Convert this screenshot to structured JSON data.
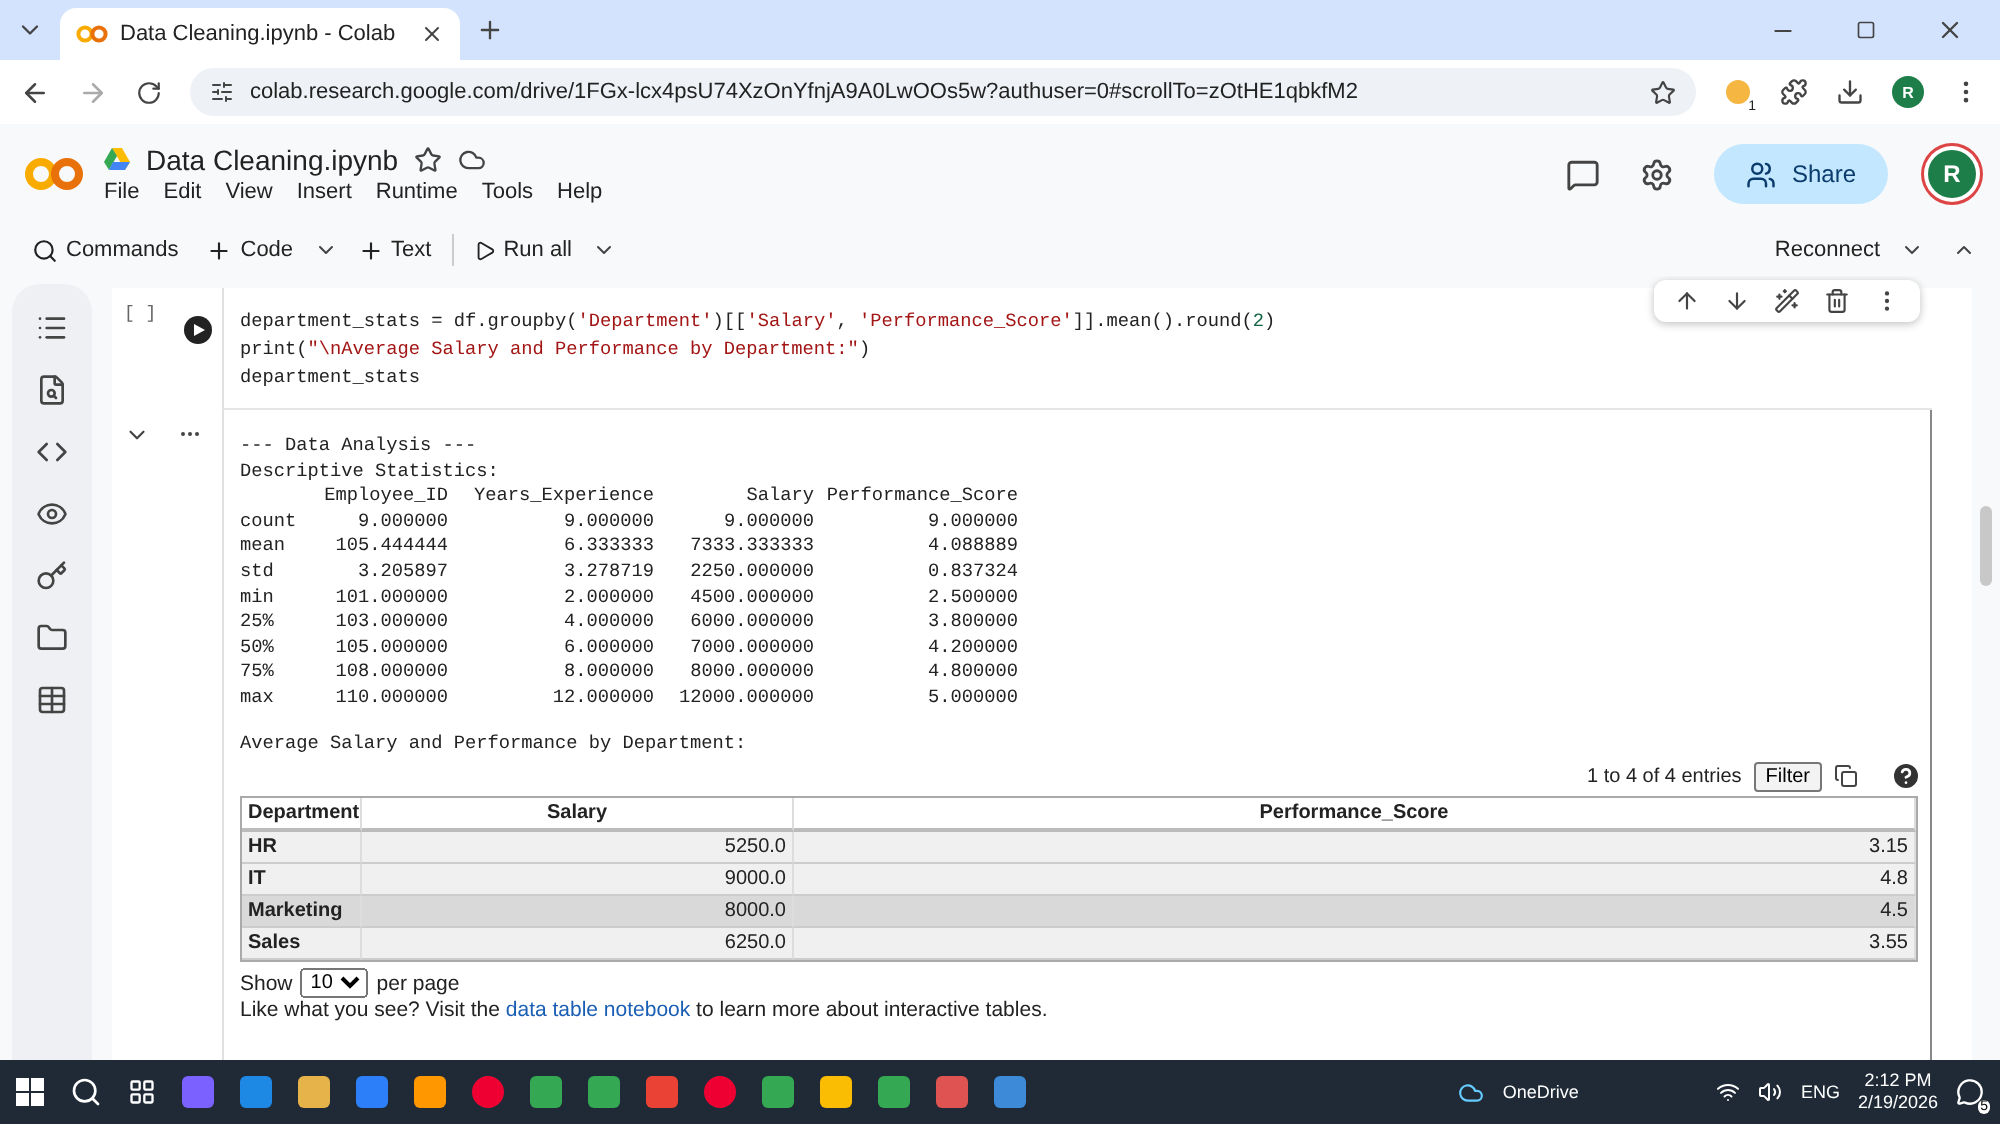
{
  "browser": {
    "tab_title": "Data Cleaning.ipynb - Colab",
    "url": "colab.research.google.com/drive/1FGx-lcx4psU74XzOnYfnjA9A0LwOOs5w?authuser=0#scrollTo=zOtHE1qbkfM2",
    "extension_badge": "1",
    "profile_initial": "R"
  },
  "notebook": {
    "title": "Data Cleaning.ipynb",
    "menu": [
      "File",
      "Edit",
      "View",
      "Insert",
      "Runtime",
      "Tools",
      "Help"
    ],
    "share": "Share",
    "avatar": "R"
  },
  "toolbar": {
    "commands": "Commands",
    "code": "Code",
    "text": "Text",
    "run_all": "Run all",
    "reconnect": "Reconnect"
  },
  "cell": {
    "exec_count": "[ ]",
    "code": [
      [
        {
          "text": "department_stats = df.groupby(",
          "kind": "plain"
        },
        {
          "text": "'Department'",
          "kind": "string"
        },
        {
          "text": ")[[",
          "kind": "plain"
        },
        {
          "text": "'Salary'",
          "kind": "string"
        },
        {
          "text": ", ",
          "kind": "plain"
        },
        {
          "text": "'Performance_Score'",
          "kind": "string"
        },
        {
          "text": "]].mean().round(",
          "kind": "plain"
        },
        {
          "text": "2",
          "kind": "number"
        },
        {
          "text": ")",
          "kind": "plain"
        }
      ],
      [
        {
          "text": "print(",
          "kind": "plain"
        },
        {
          "text": "\"\\nAverage Salary and Performance by Department:\"",
          "kind": "string"
        },
        {
          "text": ")",
          "kind": "plain"
        }
      ],
      [
        {
          "text": "department_stats",
          "kind": "plain"
        }
      ]
    ]
  },
  "output": {
    "lines": [
      "--- Data Analysis ---",
      "Descriptive Statistics:"
    ],
    "stats": {
      "columns": [
        "",
        "Employee_ID",
        "Years_Experience",
        "Salary",
        "Performance_Score"
      ],
      "rows": [
        [
          "count",
          "9.000000",
          "9.000000",
          "9.000000",
          "9.000000"
        ],
        [
          "mean",
          "105.444444",
          "6.333333",
          "7333.333333",
          "4.088889"
        ],
        [
          "std",
          "3.205897",
          "3.278719",
          "2250.000000",
          "0.837324"
        ],
        [
          "min",
          "101.000000",
          "2.000000",
          "4500.000000",
          "2.500000"
        ],
        [
          "25%",
          "103.000000",
          "4.000000",
          "6000.000000",
          "3.800000"
        ],
        [
          "50%",
          "105.000000",
          "6.000000",
          "7000.000000",
          "4.200000"
        ],
        [
          "75%",
          "108.000000",
          "8.000000",
          "8000.000000",
          "4.800000"
        ],
        [
          "max",
          "110.000000",
          "12.000000",
          "12000.000000",
          "5.000000"
        ]
      ]
    },
    "heading": "Average Salary and Performance by Department:",
    "table": {
      "entries": "1 to 4 of 4 entries",
      "filter": "Filter",
      "columns": [
        "Department",
        "Salary",
        "Performance_Score"
      ],
      "rows": [
        {
          "cells": [
            "HR",
            "5250.0",
            "3.15"
          ],
          "selected": false
        },
        {
          "cells": [
            "IT",
            "9000.0",
            "4.8"
          ],
          "selected": false
        },
        {
          "cells": [
            "Marketing",
            "8000.0",
            "4.5"
          ],
          "selected": true
        },
        {
          "cells": [
            "Sales",
            "6250.0",
            "3.55"
          ],
          "selected": false
        }
      ],
      "show": "Show",
      "page_size": "10",
      "per_page": "per page",
      "footer_before": "Like what you see? Visit the ",
      "footer_link": "data table notebook",
      "footer_after": " to learn more about interactive tables."
    }
  },
  "taskbar": {
    "onedrive": "OneDrive",
    "language": "ENG",
    "time": "2:12 PM",
    "date": "2/19/2026",
    "notifications": "5"
  }
}
